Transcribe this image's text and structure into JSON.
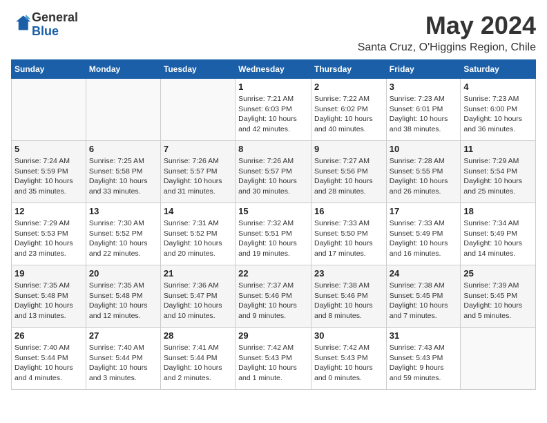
{
  "header": {
    "logo_line1": "General",
    "logo_line2": "Blue",
    "month_title": "May 2024",
    "subtitle": "Santa Cruz, O'Higgins Region, Chile"
  },
  "days_of_week": [
    "Sunday",
    "Monday",
    "Tuesday",
    "Wednesday",
    "Thursday",
    "Friday",
    "Saturday"
  ],
  "weeks": [
    [
      {
        "num": "",
        "info": ""
      },
      {
        "num": "",
        "info": ""
      },
      {
        "num": "",
        "info": ""
      },
      {
        "num": "1",
        "info": "Sunrise: 7:21 AM\nSunset: 6:03 PM\nDaylight: 10 hours\nand 42 minutes."
      },
      {
        "num": "2",
        "info": "Sunrise: 7:22 AM\nSunset: 6:02 PM\nDaylight: 10 hours\nand 40 minutes."
      },
      {
        "num": "3",
        "info": "Sunrise: 7:23 AM\nSunset: 6:01 PM\nDaylight: 10 hours\nand 38 minutes."
      },
      {
        "num": "4",
        "info": "Sunrise: 7:23 AM\nSunset: 6:00 PM\nDaylight: 10 hours\nand 36 minutes."
      }
    ],
    [
      {
        "num": "5",
        "info": "Sunrise: 7:24 AM\nSunset: 5:59 PM\nDaylight: 10 hours\nand 35 minutes."
      },
      {
        "num": "6",
        "info": "Sunrise: 7:25 AM\nSunset: 5:58 PM\nDaylight: 10 hours\nand 33 minutes."
      },
      {
        "num": "7",
        "info": "Sunrise: 7:26 AM\nSunset: 5:57 PM\nDaylight: 10 hours\nand 31 minutes."
      },
      {
        "num": "8",
        "info": "Sunrise: 7:26 AM\nSunset: 5:57 PM\nDaylight: 10 hours\nand 30 minutes."
      },
      {
        "num": "9",
        "info": "Sunrise: 7:27 AM\nSunset: 5:56 PM\nDaylight: 10 hours\nand 28 minutes."
      },
      {
        "num": "10",
        "info": "Sunrise: 7:28 AM\nSunset: 5:55 PM\nDaylight: 10 hours\nand 26 minutes."
      },
      {
        "num": "11",
        "info": "Sunrise: 7:29 AM\nSunset: 5:54 PM\nDaylight: 10 hours\nand 25 minutes."
      }
    ],
    [
      {
        "num": "12",
        "info": "Sunrise: 7:29 AM\nSunset: 5:53 PM\nDaylight: 10 hours\nand 23 minutes."
      },
      {
        "num": "13",
        "info": "Sunrise: 7:30 AM\nSunset: 5:52 PM\nDaylight: 10 hours\nand 22 minutes."
      },
      {
        "num": "14",
        "info": "Sunrise: 7:31 AM\nSunset: 5:52 PM\nDaylight: 10 hours\nand 20 minutes."
      },
      {
        "num": "15",
        "info": "Sunrise: 7:32 AM\nSunset: 5:51 PM\nDaylight: 10 hours\nand 19 minutes."
      },
      {
        "num": "16",
        "info": "Sunrise: 7:33 AM\nSunset: 5:50 PM\nDaylight: 10 hours\nand 17 minutes."
      },
      {
        "num": "17",
        "info": "Sunrise: 7:33 AM\nSunset: 5:49 PM\nDaylight: 10 hours\nand 16 minutes."
      },
      {
        "num": "18",
        "info": "Sunrise: 7:34 AM\nSunset: 5:49 PM\nDaylight: 10 hours\nand 14 minutes."
      }
    ],
    [
      {
        "num": "19",
        "info": "Sunrise: 7:35 AM\nSunset: 5:48 PM\nDaylight: 10 hours\nand 13 minutes."
      },
      {
        "num": "20",
        "info": "Sunrise: 7:35 AM\nSunset: 5:48 PM\nDaylight: 10 hours\nand 12 minutes."
      },
      {
        "num": "21",
        "info": "Sunrise: 7:36 AM\nSunset: 5:47 PM\nDaylight: 10 hours\nand 10 minutes."
      },
      {
        "num": "22",
        "info": "Sunrise: 7:37 AM\nSunset: 5:46 PM\nDaylight: 10 hours\nand 9 minutes."
      },
      {
        "num": "23",
        "info": "Sunrise: 7:38 AM\nSunset: 5:46 PM\nDaylight: 10 hours\nand 8 minutes."
      },
      {
        "num": "24",
        "info": "Sunrise: 7:38 AM\nSunset: 5:45 PM\nDaylight: 10 hours\nand 7 minutes."
      },
      {
        "num": "25",
        "info": "Sunrise: 7:39 AM\nSunset: 5:45 PM\nDaylight: 10 hours\nand 5 minutes."
      }
    ],
    [
      {
        "num": "26",
        "info": "Sunrise: 7:40 AM\nSunset: 5:44 PM\nDaylight: 10 hours\nand 4 minutes."
      },
      {
        "num": "27",
        "info": "Sunrise: 7:40 AM\nSunset: 5:44 PM\nDaylight: 10 hours\nand 3 minutes."
      },
      {
        "num": "28",
        "info": "Sunrise: 7:41 AM\nSunset: 5:44 PM\nDaylight: 10 hours\nand 2 minutes."
      },
      {
        "num": "29",
        "info": "Sunrise: 7:42 AM\nSunset: 5:43 PM\nDaylight: 10 hours\nand 1 minute."
      },
      {
        "num": "30",
        "info": "Sunrise: 7:42 AM\nSunset: 5:43 PM\nDaylight: 10 hours\nand 0 minutes."
      },
      {
        "num": "31",
        "info": "Sunrise: 7:43 AM\nSunset: 5:43 PM\nDaylight: 9 hours\nand 59 minutes."
      },
      {
        "num": "",
        "info": ""
      }
    ]
  ]
}
